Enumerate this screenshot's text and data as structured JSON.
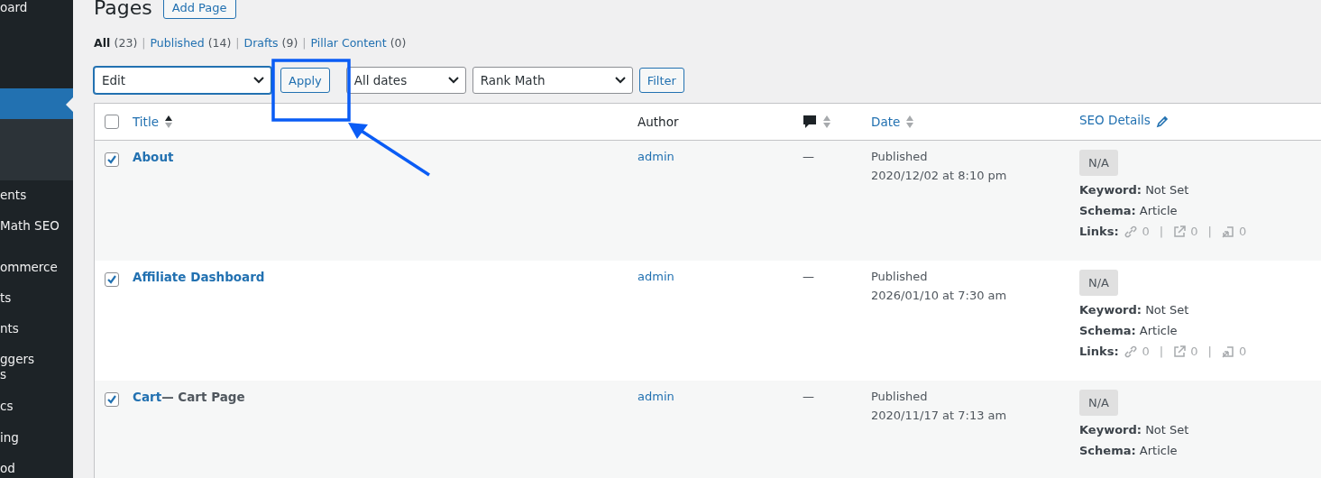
{
  "sidebar": {
    "items": [
      {
        "kind": "item",
        "label": "oard"
      },
      {
        "kind": "current"
      },
      {
        "kind": "item",
        "label": "ents"
      },
      {
        "kind": "item",
        "label": "Math SEO"
      },
      {
        "kind": "item",
        "label": "ommerce"
      },
      {
        "kind": "item",
        "label": "ts"
      },
      {
        "kind": "item",
        "label": "nts"
      },
      {
        "kind": "item",
        "label": "ggers\ns"
      },
      {
        "kind": "item",
        "label": "cs"
      },
      {
        "kind": "item",
        "label": "ing"
      },
      {
        "kind": "item",
        "label": "od"
      }
    ]
  },
  "page_title": "Pages",
  "add_button": "Add Page",
  "views": [
    {
      "label": "All",
      "count": "(23)",
      "selected": true
    },
    {
      "separator": "|",
      "label": "Published",
      "count": "(14)",
      "selected": false
    },
    {
      "separator": "|",
      "label": "Drafts",
      "count": "(9)",
      "selected": false
    },
    {
      "separator": "|",
      "label": "Pillar Content",
      "count": "(0)",
      "selected": false
    }
  ],
  "toolbar": {
    "bulk_action": "Edit",
    "apply": "Apply",
    "date_filter": "All dates",
    "seo_filter": "Rank Math",
    "filter": "Filter"
  },
  "table": {
    "select_all_checked": false,
    "columns": [
      {
        "kind": "sortable",
        "label": "Title",
        "sorted": true
      },
      {
        "kind": "plain",
        "label": "Author"
      },
      {
        "kind": "comments",
        "sorted": false
      },
      {
        "kind": "sortable",
        "label": "Date",
        "sorted": false
      },
      {
        "kind": "seo",
        "label": "SEO Details"
      }
    ],
    "rows": [
      {
        "checked": true,
        "title": "About",
        "author": "admin",
        "comments": "—",
        "status": "Published",
        "date": "2020/12/02 at 8:10 pm",
        "score": "N/A",
        "keyword_label": "Keyword:",
        "keyword": "Not Set",
        "schema_label": "Schema:",
        "schema": "Article",
        "links_label": "Links:",
        "links": [
          {
            "count": "0"
          },
          {
            "separator": "|",
            "count": "0"
          },
          {
            "separator": "|",
            "count": "0"
          }
        ]
      },
      {
        "checked": true,
        "title": "Affiliate Dashboard",
        "author": "admin",
        "comments": "—",
        "status": "Published",
        "date": "2026/01/10 at 7:30 am",
        "score": "N/A",
        "keyword_label": "Keyword:",
        "keyword": "Not Set",
        "schema_label": "Schema:",
        "schema": "Article",
        "links_label": "Links:",
        "links": [
          {
            "count": "0"
          },
          {
            "separator": "|",
            "count": "0"
          },
          {
            "separator": "|",
            "count": "0"
          }
        ]
      },
      {
        "checked": true,
        "title": "Cart",
        "suffix": "— Cart Page",
        "author": "admin",
        "comments": "—",
        "status": "Published",
        "date": "2020/11/17 at 7:13 am",
        "score": "N/A",
        "keyword_label": "Keyword:",
        "keyword": "Not Set",
        "schema_label": "Schema:",
        "schema": "Article"
      }
    ]
  }
}
